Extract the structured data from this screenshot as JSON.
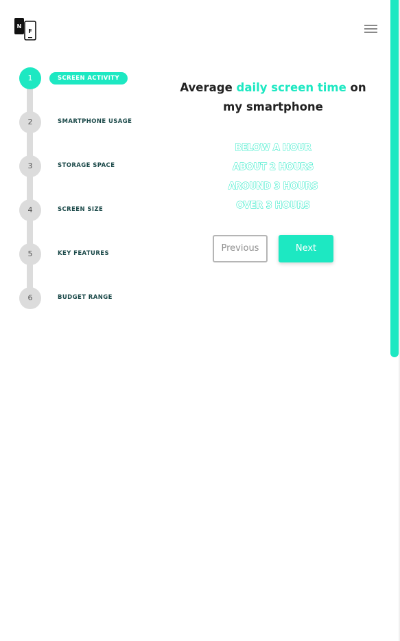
{
  "header": {
    "logo_letters": [
      "N",
      "F"
    ],
    "menu_icon": "hamburger-menu-icon"
  },
  "stepper": {
    "steps": [
      {
        "number": "1",
        "label": "SCREEN ACTIVITY",
        "active": true
      },
      {
        "number": "2",
        "label": "SMARTPHONE USAGE",
        "active": false
      },
      {
        "number": "3",
        "label": "STORAGE SPACE",
        "active": false
      },
      {
        "number": "4",
        "label": "SCREEN SIZE",
        "active": false
      },
      {
        "number": "5",
        "label": "KEY FEATURES",
        "active": false
      },
      {
        "number": "6",
        "label": "BUDGET RANGE",
        "active": false
      }
    ]
  },
  "question": {
    "prefix": "Average ",
    "highlight": "daily screen time",
    "suffix": " on my smartphone"
  },
  "options": [
    "BELOW A HOUR",
    "ABOUT 2 HOURS",
    "AROUND 3 HOURS",
    "OVER 3 HOURS"
  ],
  "buttons": {
    "previous": "Previous",
    "next": "Next"
  },
  "colors": {
    "accent": "#1de8c2",
    "step_inactive": "#dcdcdc",
    "step_label": "#1c4a4a",
    "text_dark": "#222222"
  }
}
